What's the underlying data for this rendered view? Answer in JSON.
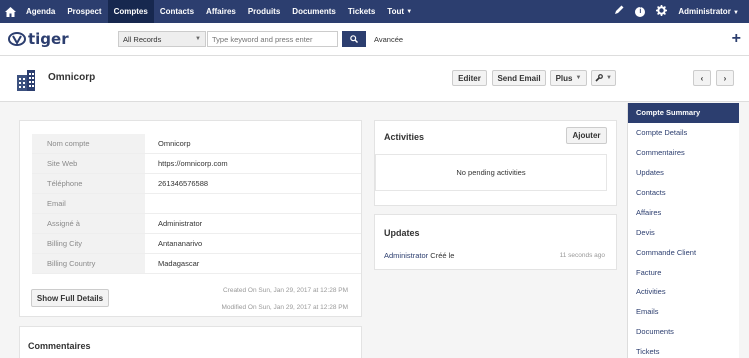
{
  "topnav": {
    "menu": [
      "Agenda",
      "Prospect",
      "Comptes",
      "Contacts",
      "Affaires",
      "Produits",
      "Documents",
      "Tickets",
      "Tout"
    ],
    "active_index": 2,
    "user": "Administrator"
  },
  "search": {
    "select_value": "All Records",
    "placeholder": "Type keyword and press enter",
    "advanced": "Avancée"
  },
  "record": {
    "name": "Omnicorp",
    "buttons": {
      "edit": "Editer",
      "send_email": "Send Email",
      "more": "Plus"
    }
  },
  "summary": {
    "fields": [
      {
        "label": "Nom compte",
        "value": "Omnicorp"
      },
      {
        "label": "Site Web",
        "value": "https://omnicorp.com"
      },
      {
        "label": "Téléphone",
        "value": "261346576588"
      },
      {
        "label": "Email",
        "value": ""
      },
      {
        "label": "Assigné à",
        "value": "Administrator"
      },
      {
        "label": "Billing City",
        "value": "Antananarivo"
      },
      {
        "label": "Billing Country",
        "value": "Madagascar"
      }
    ],
    "show_full": "Show Full Details",
    "created": "Created On Sun, Jan 29, 2017 at 12:28 PM",
    "modified": "Modified On Sun, Jan 29, 2017 at 12:28 PM"
  },
  "activities": {
    "title": "Activities",
    "add": "Ajouter",
    "empty": "No pending activities"
  },
  "updates": {
    "title": "Updates",
    "who": "Administrator",
    "action": "Créé le",
    "when": "11 seconds ago"
  },
  "comments": {
    "title": "Commentaires"
  },
  "sidebar": {
    "items": [
      "Compte Summary",
      "Compte Details",
      "Commentaires",
      "Updates",
      "Contacts",
      "Affaires",
      "Devis",
      "Commande Client",
      "Facture",
      "Activities",
      "Emails",
      "Documents",
      "Tickets"
    ],
    "active_index": 0
  },
  "colors": {
    "nav": "#2c3e6f",
    "nav_active": "#17284f"
  }
}
